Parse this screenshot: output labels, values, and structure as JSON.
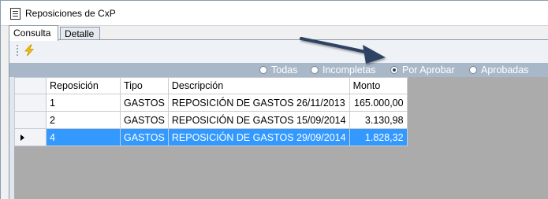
{
  "window": {
    "title": "Reposiciones de CxP"
  },
  "tabs": [
    {
      "label": "Consulta",
      "active": true
    },
    {
      "label": "Detalle",
      "active": false
    }
  ],
  "toolbar": {
    "icon": "lightning-bolt-icon"
  },
  "filters": {
    "options": [
      {
        "label": "Todas",
        "checked": false
      },
      {
        "label": "Incompletas",
        "checked": false
      },
      {
        "label": "Por Aprobar",
        "checked": true
      },
      {
        "label": "Aprobadas",
        "checked": false
      }
    ]
  },
  "grid": {
    "columns": [
      "Reposición",
      "Tipo",
      "Descripción",
      "Monto"
    ],
    "rows": [
      {
        "reposicion": "1",
        "tipo": "GASTOS",
        "descripcion": "REPOSICIÓN DE GASTOS 26/11/2013",
        "monto": "165.000,00",
        "selected": false
      },
      {
        "reposicion": "2",
        "tipo": "GASTOS",
        "descripcion": "REPOSICIÓN DE GASTOS 15/09/2014",
        "monto": "3.130,98",
        "selected": false
      },
      {
        "reposicion": "4",
        "tipo": "GASTOS",
        "descripcion": "REPOSICIÓN DE GASTOS 29/09/2014",
        "monto": "1.828,32",
        "selected": true
      }
    ]
  },
  "colors": {
    "selection": "#3399ff",
    "filterbar": "#a9b8c9",
    "arrow": "#2f4262"
  }
}
